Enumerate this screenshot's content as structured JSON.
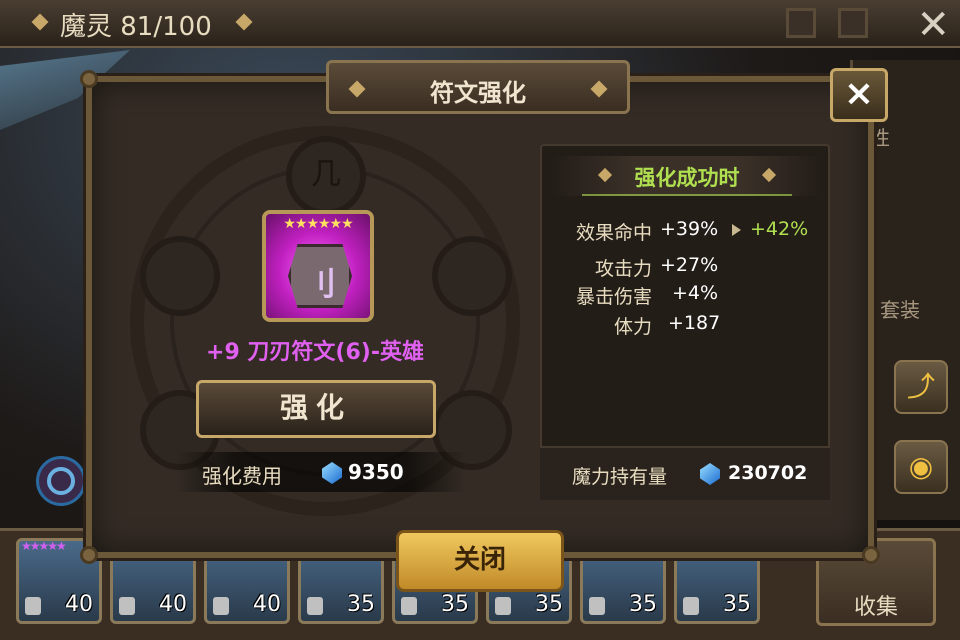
{
  "topbar": {
    "title": "魔灵 81/100"
  },
  "dialog": {
    "title": "符文强化",
    "close_label": "×",
    "rune": {
      "stars": "★★★★★★",
      "glyph": "刂",
      "name": "+9 刀刃符文(6)-英雄"
    },
    "enhance_label": "强化",
    "cost": {
      "label": "强化费用",
      "value": "9350"
    },
    "stats": {
      "header": "强化成功时",
      "rows": [
        {
          "name": "效果命中",
          "value": "+39%",
          "new_value": "+42%"
        },
        {
          "name": "攻击力",
          "value": "+27%"
        },
        {
          "name": "暴击伤害",
          "value": "+4%"
        },
        {
          "name": "体力",
          "value": "+187"
        }
      ]
    },
    "mana": {
      "label": "魔力持有量",
      "value": "230702"
    },
    "close_main_label": "关闭"
  },
  "circle_nodes": [
    "几",
    "",
    "",
    "",
    ""
  ],
  "side": {
    "text_a": "性",
    "text_b": "套装"
  },
  "heroes": [
    {
      "level": "40",
      "stars": "★★★★★"
    },
    {
      "level": "40",
      "stars": ""
    },
    {
      "level": "40",
      "stars": ""
    },
    {
      "level": "35",
      "stars": ""
    },
    {
      "level": "35",
      "stars": ""
    },
    {
      "level": "35",
      "stars": ""
    },
    {
      "level": "35",
      "stars": ""
    },
    {
      "level": "35",
      "stars": ""
    }
  ],
  "collect_label": "收集",
  "colors": {
    "accent_green": "#b0e050",
    "rune_pink": "#e060f0",
    "gold_button": "#f0c860"
  }
}
